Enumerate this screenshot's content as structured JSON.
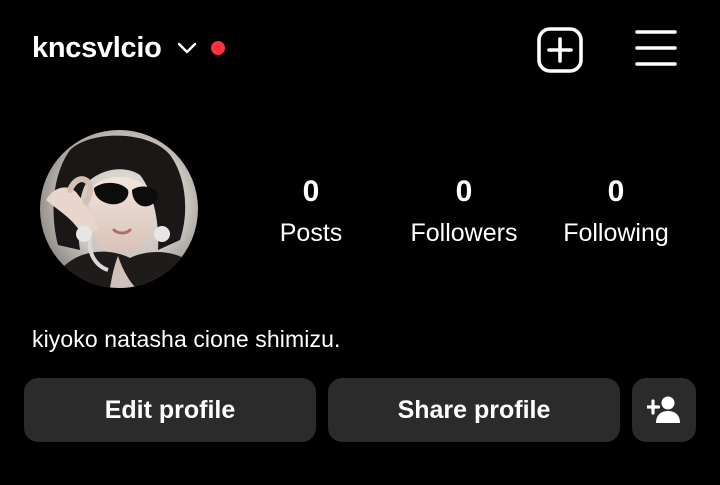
{
  "header": {
    "username": "kncsvlcio",
    "chevron_icon": "chevron-down-icon",
    "notification_dot_color": "#ff3040",
    "create_icon": "plus-square-icon",
    "menu_icon": "hamburger-menu-icon"
  },
  "profile": {
    "avatar_icon": "profile-photo",
    "stats": [
      {
        "value": "0",
        "label": "Posts"
      },
      {
        "value": "0",
        "label": "Followers"
      },
      {
        "value": "0",
        "label": "Following"
      }
    ],
    "bio": "kiyoko natasha cione shimizu."
  },
  "actions": {
    "edit_label": "Edit profile",
    "share_label": "Share profile",
    "discover_icon": "add-person-icon"
  },
  "colors": {
    "background": "#000000",
    "button_bg": "#2b2b2b",
    "text": "#ffffff"
  }
}
